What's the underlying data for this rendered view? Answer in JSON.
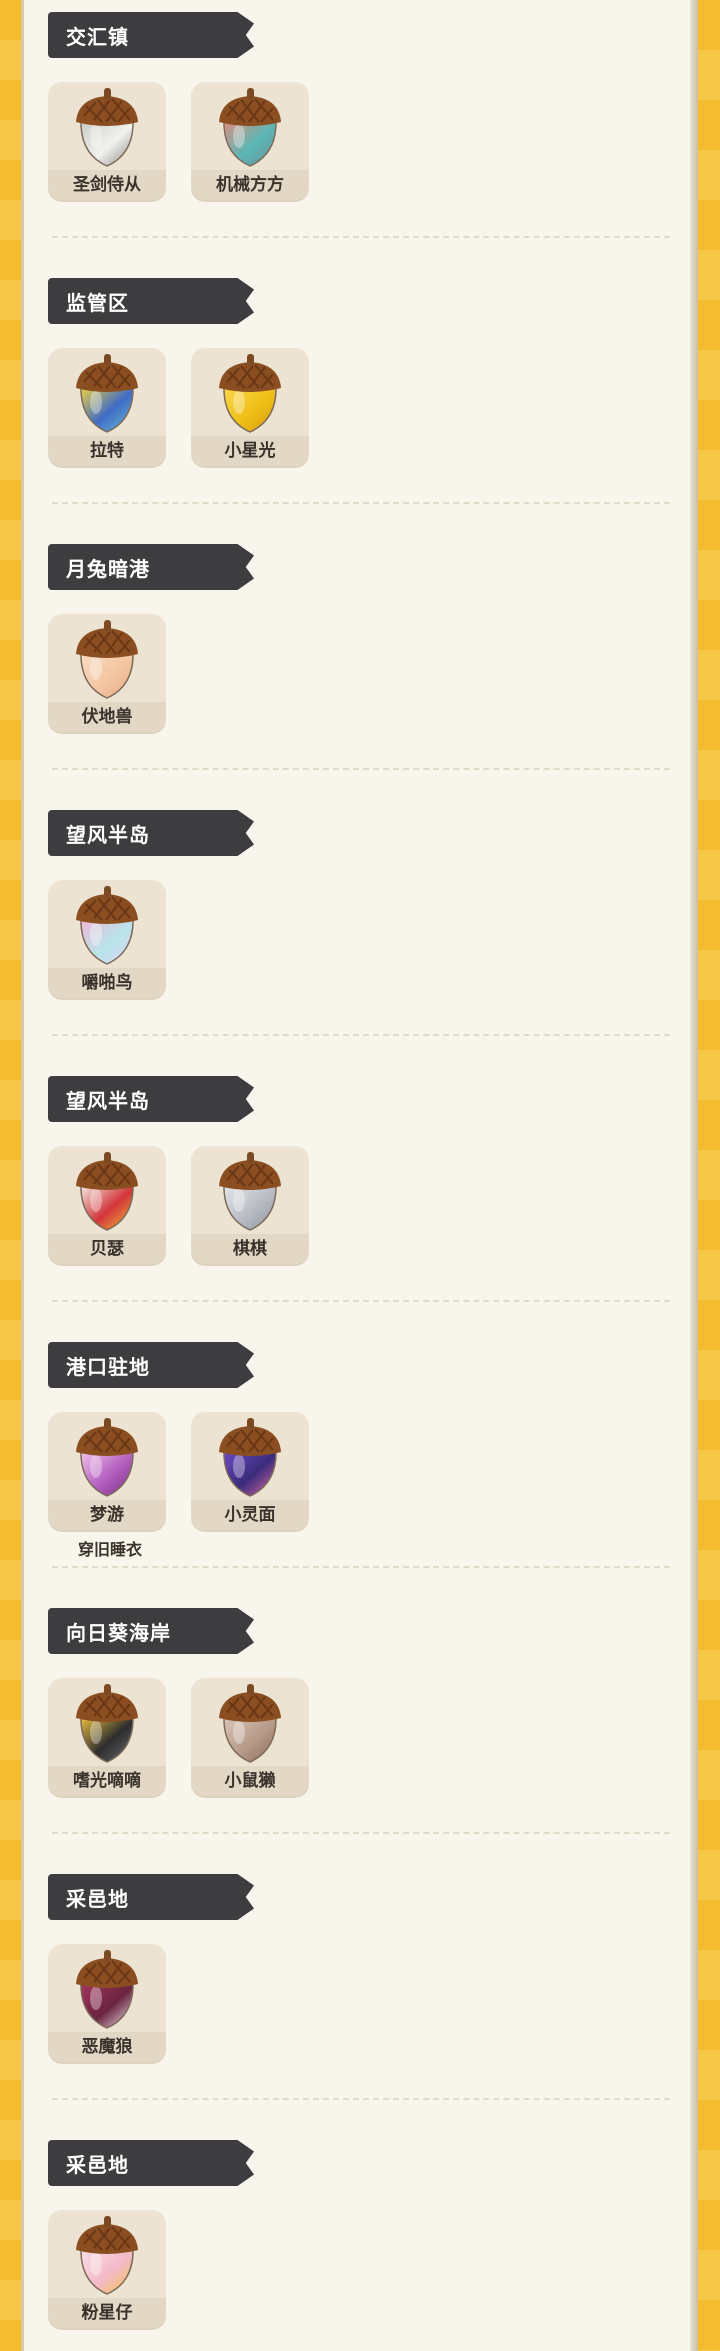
{
  "regions": [
    {
      "title": "交汇镇",
      "items": [
        {
          "name": "圣剑侍从",
          "icon": "acorn-white-swirl-icon",
          "colors": [
            "#f1f1ee",
            "#c9c9c4",
            "#8f8a85"
          ]
        },
        {
          "name": "机械方方",
          "icon": "acorn-checker-icon",
          "colors": [
            "#5bb7b4",
            "#e18d7f",
            "#6b8e98"
          ]
        }
      ]
    },
    {
      "title": "监管区",
      "items": [
        {
          "name": "拉特",
          "icon": "acorn-stripe-icon",
          "colors": [
            "#3f6cc5",
            "#f3d43a",
            "#6ac1d9"
          ]
        },
        {
          "name": "小星光",
          "icon": "acorn-star-icon",
          "colors": [
            "#f0bf16",
            "#f7d84a",
            "#d19b08"
          ]
        }
      ]
    },
    {
      "title": "月兔暗港",
      "items": [
        {
          "name": "伏地兽",
          "icon": "acorn-peach-icon",
          "colors": [
            "#f3c6a1",
            "#f9ddc4",
            "#e8a98a"
          ]
        }
      ]
    },
    {
      "title": "望风半岛",
      "items": [
        {
          "name": "嚼啪鸟",
          "icon": "acorn-pastel-icon",
          "colors": [
            "#b9e3ea",
            "#f0b6d7",
            "#dcd7f2"
          ]
        }
      ]
    },
    {
      "title": "望风半岛",
      "items": [
        {
          "name": "贝瑟",
          "icon": "acorn-red-white-icon",
          "colors": [
            "#d3353a",
            "#f4f0ea",
            "#f2c23a"
          ]
        },
        {
          "name": "棋棋",
          "icon": "acorn-silver-icon",
          "colors": [
            "#b8bcc4",
            "#e6e8ec",
            "#8e939c"
          ]
        }
      ]
    },
    {
      "title": "港口驻地",
      "items": [
        {
          "name": "梦游",
          "icon": "acorn-purple-swirl-icon",
          "colors": [
            "#b35fc0",
            "#f1c6ea",
            "#7a2e86"
          ]
        },
        {
          "name": "小灵面",
          "icon": "acorn-galaxy-icon",
          "colors": [
            "#3a2c7a",
            "#6e4bc6",
            "#e86aa8"
          ]
        }
      ],
      "note": "穿旧睡衣"
    },
    {
      "title": "向日葵海岸",
      "items": [
        {
          "name": "嗜光嘀嘀",
          "icon": "acorn-black-yellow-icon",
          "colors": [
            "#2e2e30",
            "#f0c43a",
            "#6c6c70"
          ]
        },
        {
          "name": "小鼠獭",
          "icon": "acorn-brown-icon",
          "colors": [
            "#b79a88",
            "#dac7bb",
            "#8a6c5e"
          ]
        }
      ]
    },
    {
      "title": "采邑地",
      "items": [
        {
          "name": "恶魔狼",
          "icon": "acorn-dark-star-icon",
          "colors": [
            "#6a2440",
            "#a8355f",
            "#f3eaf0"
          ]
        }
      ]
    },
    {
      "title": "采邑地",
      "items": [
        {
          "name": "粉星仔",
          "icon": "acorn-pink-star-icon",
          "colors": [
            "#f3b9c8",
            "#f8dfe6",
            "#f3c64a"
          ]
        }
      ]
    }
  ]
}
